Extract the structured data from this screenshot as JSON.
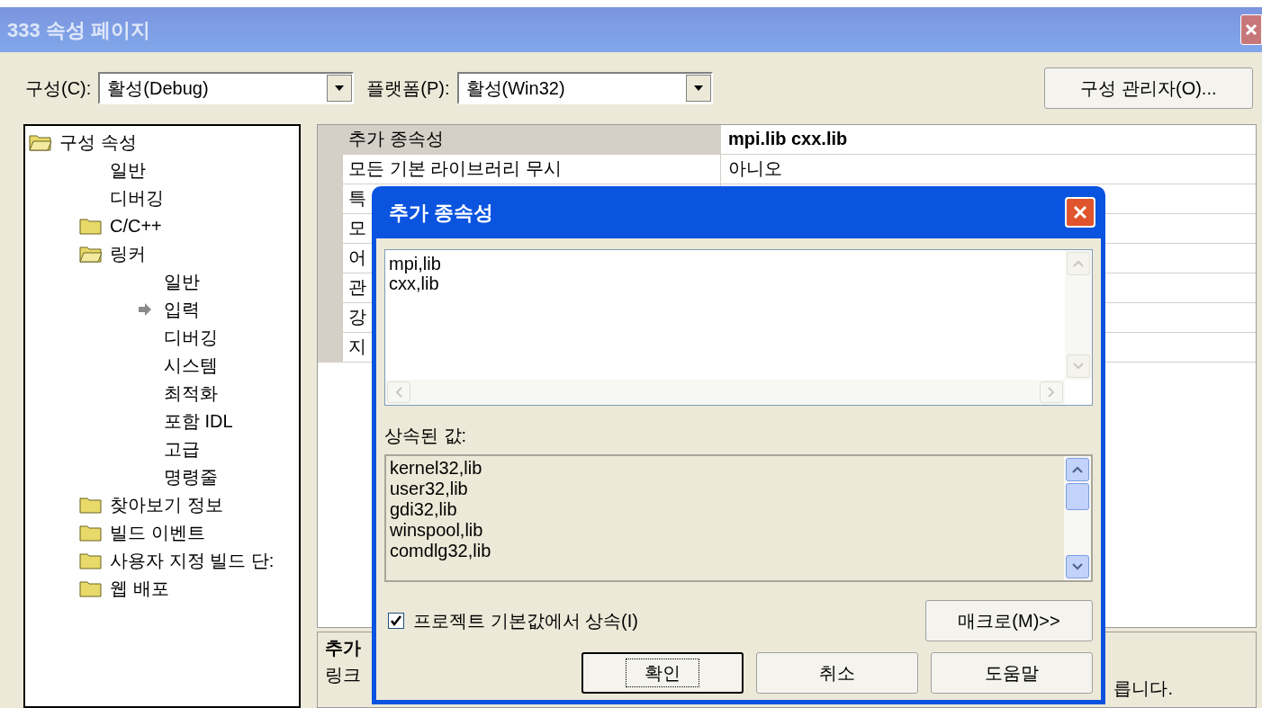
{
  "window": {
    "title": "333 속성 페이지"
  },
  "toolbar": {
    "configuration": {
      "label": "구성(C):",
      "value": "활성(Debug)"
    },
    "platform": {
      "label": "플랫폼(P):",
      "value": "활성(Win32)"
    },
    "manager_button": "구성 관리자(O)..."
  },
  "tree": [
    {
      "label": "구성 속성",
      "kind": "folder",
      "expanded": true,
      "children": [
        {
          "label": "일반",
          "kind": "page",
          "selected": false
        },
        {
          "label": "디버깅",
          "kind": "page",
          "selected": false
        },
        {
          "label": "C/C++",
          "kind": "folder",
          "expanded": false
        },
        {
          "label": "링커",
          "kind": "folder",
          "expanded": true,
          "children": [
            {
              "label": "일반",
              "kind": "page",
              "selected": false
            },
            {
              "label": "입력",
              "kind": "page",
              "selected": true
            },
            {
              "label": "디버깅",
              "kind": "page",
              "selected": false
            },
            {
              "label": "시스템",
              "kind": "page",
              "selected": false
            },
            {
              "label": "최적화",
              "kind": "page",
              "selected": false
            },
            {
              "label": "포함 IDL",
              "kind": "page",
              "selected": false
            },
            {
              "label": "고급",
              "kind": "page",
              "selected": false
            },
            {
              "label": "명령줄",
              "kind": "page",
              "selected": false
            }
          ]
        },
        {
          "label": "찾아보기 정보",
          "kind": "folder",
          "expanded": false
        },
        {
          "label": "빌드 이벤트",
          "kind": "folder",
          "expanded": false
        },
        {
          "label": "사용자 지정 빌드 단:",
          "kind": "folder",
          "expanded": false
        },
        {
          "label": "웹 배포",
          "kind": "folder",
          "expanded": false
        }
      ]
    }
  ],
  "properties": [
    {
      "name": "추가 종속성",
      "value": "mpi.lib cxx.lib",
      "selected": true
    },
    {
      "name": "모든 기본 라이브러리 무시",
      "value": "아니오",
      "selected": false
    },
    {
      "name": "특",
      "selected": false
    },
    {
      "name": "모",
      "selected": false
    },
    {
      "name": "어",
      "selected": false
    },
    {
      "name": "관",
      "selected": false
    },
    {
      "name": "강",
      "selected": false
    },
    {
      "name": "지",
      "selected": false
    }
  ],
  "description": {
    "title": "추가",
    "text": "링크",
    "text_end": "릅니다."
  },
  "dialog": {
    "title": "추가 종속성",
    "value_lines": [
      "mpi,lib",
      "cxx,lib"
    ],
    "inherited_label": "상속된 값:",
    "inherited_lines": [
      "kernel32,lib",
      "user32,lib",
      "gdi32,lib",
      "winspool,lib",
      "comdlg32,lib"
    ],
    "inherit_checkbox": {
      "label": "프로젝트 기본값에서 상속(I)",
      "checked": true
    },
    "macro_button": "매크로(M)>>",
    "buttons": [
      {
        "label": "확인",
        "default": true
      },
      {
        "label": "취소",
        "default": false
      },
      {
        "label": "도움말",
        "default": false
      }
    ]
  }
}
